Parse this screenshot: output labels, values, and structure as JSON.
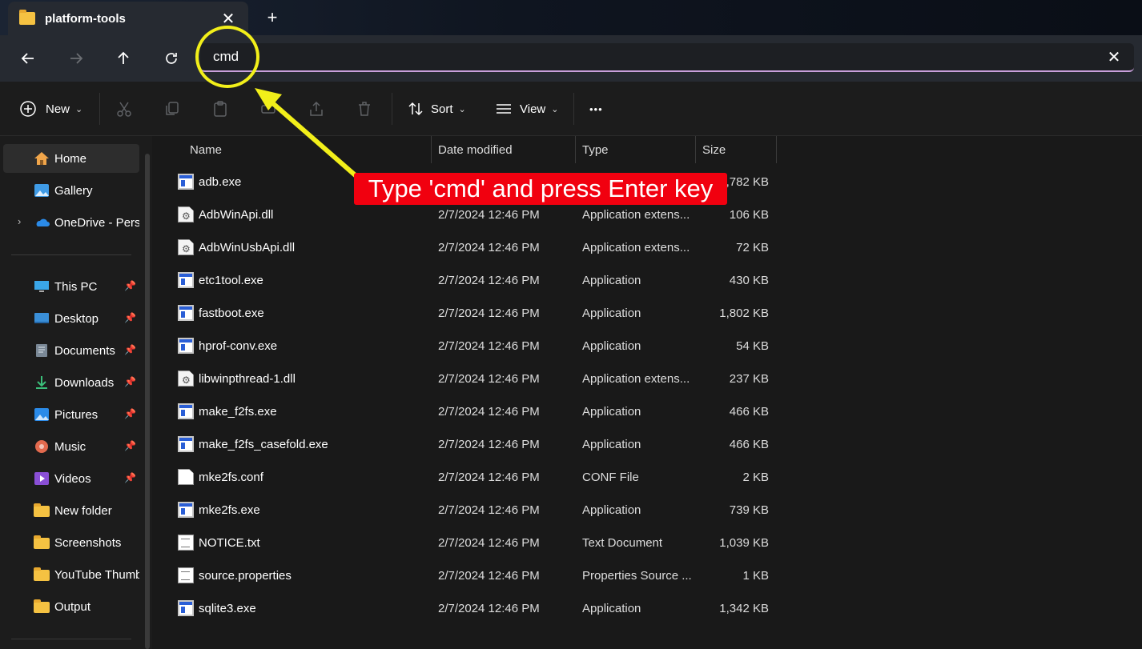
{
  "tab": {
    "title": "platform-tools",
    "close_glyph": "✕",
    "new_tab_glyph": "+"
  },
  "address_bar": {
    "value": "cmd",
    "clear_glyph": "✕"
  },
  "toolbar": {
    "new_label": "New",
    "sort_label": "Sort",
    "view_label": "View",
    "more_glyph": "•••"
  },
  "sidebar": {
    "items": [
      {
        "label": "Home",
        "icon": "home-icon",
        "pinned": false
      },
      {
        "label": "Gallery",
        "icon": "gallery-icon",
        "pinned": false
      },
      {
        "label": "OneDrive - Perso",
        "icon": "onedrive-icon",
        "pinned": false
      },
      {
        "label": "This PC",
        "icon": "this-pc-icon",
        "pinned": true
      },
      {
        "label": "Desktop",
        "icon": "desktop-icon",
        "pinned": true
      },
      {
        "label": "Documents",
        "icon": "documents-icon",
        "pinned": true
      },
      {
        "label": "Downloads",
        "icon": "downloads-icon",
        "pinned": true
      },
      {
        "label": "Pictures",
        "icon": "pictures-icon",
        "pinned": true
      },
      {
        "label": "Music",
        "icon": "music-icon",
        "pinned": true
      },
      {
        "label": "Videos",
        "icon": "videos-icon",
        "pinned": true
      },
      {
        "label": "New folder",
        "icon": "folder-icon",
        "pinned": false
      },
      {
        "label": "Screenshots",
        "icon": "folder-icon",
        "pinned": false
      },
      {
        "label": "YouTube Thumb",
        "icon": "folder-icon",
        "pinned": false
      },
      {
        "label": "Output",
        "icon": "folder-icon",
        "pinned": false
      }
    ]
  },
  "columns": {
    "name": "Name",
    "date": "Date modified",
    "type": "Type",
    "size": "Size"
  },
  "files": [
    {
      "name": "adb.exe",
      "date": "",
      "type": "",
      "size": "5,782 KB",
      "icon": "exe"
    },
    {
      "name": "AdbWinApi.dll",
      "date": "2/7/2024 12:46 PM",
      "type": "Application extens...",
      "size": "106 KB",
      "icon": "dll"
    },
    {
      "name": "AdbWinUsbApi.dll",
      "date": "2/7/2024 12:46 PM",
      "type": "Application extens...",
      "size": "72 KB",
      "icon": "dll"
    },
    {
      "name": "etc1tool.exe",
      "date": "2/7/2024 12:46 PM",
      "type": "Application",
      "size": "430 KB",
      "icon": "exe"
    },
    {
      "name": "fastboot.exe",
      "date": "2/7/2024 12:46 PM",
      "type": "Application",
      "size": "1,802 KB",
      "icon": "exe"
    },
    {
      "name": "hprof-conv.exe",
      "date": "2/7/2024 12:46 PM",
      "type": "Application",
      "size": "54 KB",
      "icon": "exe"
    },
    {
      "name": "libwinpthread-1.dll",
      "date": "2/7/2024 12:46 PM",
      "type": "Application extens...",
      "size": "237 KB",
      "icon": "dll"
    },
    {
      "name": "make_f2fs.exe",
      "date": "2/7/2024 12:46 PM",
      "type": "Application",
      "size": "466 KB",
      "icon": "exe"
    },
    {
      "name": "make_f2fs_casefold.exe",
      "date": "2/7/2024 12:46 PM",
      "type": "Application",
      "size": "466 KB",
      "icon": "exe"
    },
    {
      "name": "mke2fs.conf",
      "date": "2/7/2024 12:46 PM",
      "type": "CONF File",
      "size": "2 KB",
      "icon": "doc"
    },
    {
      "name": "mke2fs.exe",
      "date": "2/7/2024 12:46 PM",
      "type": "Application",
      "size": "739 KB",
      "icon": "exe"
    },
    {
      "name": "NOTICE.txt",
      "date": "2/7/2024 12:46 PM",
      "type": "Text Document",
      "size": "1,039 KB",
      "icon": "txt"
    },
    {
      "name": "source.properties",
      "date": "2/7/2024 12:46 PM",
      "type": "Properties Source ...",
      "size": "1 KB",
      "icon": "txt"
    },
    {
      "name": "sqlite3.exe",
      "date": "2/7/2024 12:46 PM",
      "type": "Application",
      "size": "1,342 KB",
      "icon": "exe"
    }
  ],
  "annotation": {
    "callout_text": "Type 'cmd' and press Enter key",
    "circle_color": "#f2ef1a",
    "arrow_color": "#f2ef1a",
    "callout_color": "#f1000f"
  }
}
